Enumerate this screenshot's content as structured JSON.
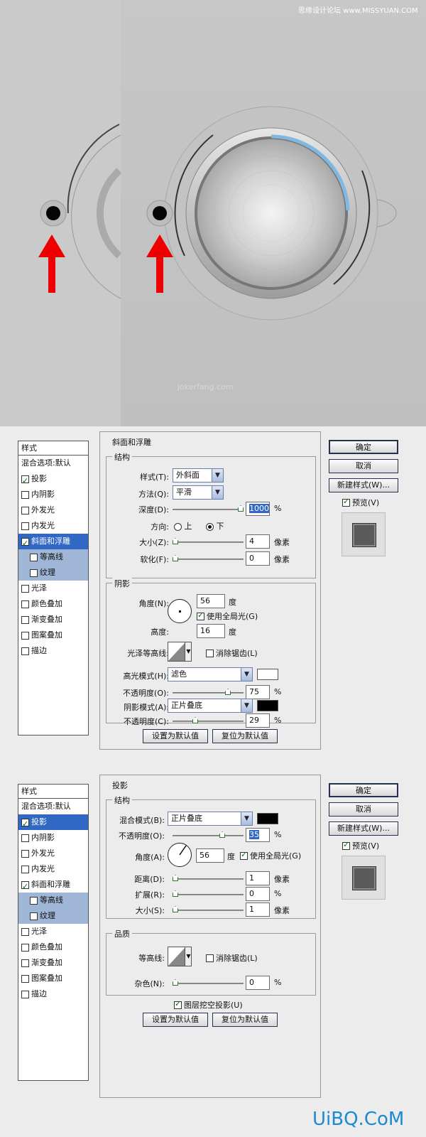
{
  "watermark_top": "思缘设计论坛 www.MISSYUAN.COM",
  "scene_watermark": "jokerfang.com",
  "footer_logo": "UiBQ.CoM",
  "panel1": {
    "styles_header": "样式",
    "styles": [
      {
        "label": "混合选项:默认",
        "check": null,
        "sub": false,
        "sel": false
      },
      {
        "label": "投影",
        "check": true,
        "sub": false,
        "sel": false
      },
      {
        "label": "内阴影",
        "check": false,
        "sub": false,
        "sel": false
      },
      {
        "label": "外发光",
        "check": false,
        "sub": false,
        "sel": false
      },
      {
        "label": "内发光",
        "check": false,
        "sub": false,
        "sel": false
      },
      {
        "label": "斜面和浮雕",
        "check": true,
        "sub": false,
        "sel": true
      },
      {
        "label": "等高线",
        "check": false,
        "sub": true,
        "sel": false
      },
      {
        "label": "纹理",
        "check": false,
        "sub": true,
        "sel": false
      },
      {
        "label": "光泽",
        "check": false,
        "sub": false,
        "sel": false
      },
      {
        "label": "颜色叠加",
        "check": false,
        "sub": false,
        "sel": false
      },
      {
        "label": "渐变叠加",
        "check": false,
        "sub": false,
        "sel": false
      },
      {
        "label": "图案叠加",
        "check": false,
        "sub": false,
        "sel": false
      },
      {
        "label": "描边",
        "check": false,
        "sub": false,
        "sel": false
      }
    ],
    "section_title": "斜面和浮雕",
    "structure_title": "结构",
    "style_label": "样式(T):",
    "style_value": "外斜面",
    "method_label": "方法(Q):",
    "method_value": "平滑",
    "depth_label": "深度(D):",
    "depth_value": "1000",
    "depth_unit": "%",
    "depth_pct": 100,
    "direction_label": "方向:",
    "dir_up": "上",
    "dir_down": "下",
    "size_label": "大小(Z):",
    "size_value": "4",
    "size_unit": "像素",
    "soften_label": "软化(F):",
    "soften_value": "0",
    "soften_unit": "像素",
    "shading_title": "阴影",
    "angle_label": "角度(N):",
    "angle_value": "56",
    "angle_unit": "度",
    "global_light": "使用全局光(G)",
    "altitude_label": "高度:",
    "altitude_value": "16",
    "altitude_unit": "度",
    "gloss_label": "光泽等高线:",
    "antialias": "消除锯齿(L)",
    "highlight_label": "高光模式(H):",
    "highlight_value": "滤色",
    "highlight_color": "#ffffff",
    "hl_opacity_label": "不透明度(O):",
    "hl_opacity_value": "75",
    "hl_opacity_unit": "%",
    "shadow_label": "阴影模式(A):",
    "shadow_value": "正片叠底",
    "shadow_color": "#000000",
    "sh_opacity_label": "不透明度(C):",
    "sh_opacity_value": "29",
    "sh_opacity_unit": "%",
    "make_default": "设置为默认值",
    "reset_default": "复位为默认值",
    "ok": "确定",
    "cancel": "取消",
    "new_style": "新建样式(W)...",
    "preview": "预览(V)"
  },
  "panel2": {
    "styles_header": "样式",
    "styles": [
      {
        "label": "混合选项:默认",
        "check": null,
        "sub": false,
        "sel": false
      },
      {
        "label": "投影",
        "check": true,
        "sub": false,
        "sel": true
      },
      {
        "label": "内阴影",
        "check": false,
        "sub": false,
        "sel": false
      },
      {
        "label": "外发光",
        "check": false,
        "sub": false,
        "sel": false
      },
      {
        "label": "内发光",
        "check": false,
        "sub": false,
        "sel": false
      },
      {
        "label": "斜面和浮雕",
        "check": true,
        "sub": false,
        "sel": false
      },
      {
        "label": "等高线",
        "check": false,
        "sub": true,
        "sel": false
      },
      {
        "label": "纹理",
        "check": false,
        "sub": true,
        "sel": false
      },
      {
        "label": "光泽",
        "check": false,
        "sub": false,
        "sel": false
      },
      {
        "label": "颜色叠加",
        "check": false,
        "sub": false,
        "sel": false
      },
      {
        "label": "渐变叠加",
        "check": false,
        "sub": false,
        "sel": false
      },
      {
        "label": "图案叠加",
        "check": false,
        "sub": false,
        "sel": false
      },
      {
        "label": "描边",
        "check": false,
        "sub": false,
        "sel": false
      }
    ],
    "section_title": "投影",
    "structure_title": "结构",
    "blend_label": "混合模式(B):",
    "blend_value": "正片叠底",
    "blend_color": "#000000",
    "opacity_label": "不透明度(O):",
    "opacity_value": "35",
    "opacity_unit": "%",
    "angle_label": "角度(A):",
    "angle_value": "56",
    "angle_unit": "度",
    "global_light": "使用全局光(G)",
    "distance_label": "距离(D):",
    "distance_value": "1",
    "distance_unit": "像素",
    "spread_label": "扩展(R):",
    "spread_value": "0",
    "spread_unit": "%",
    "size_label": "大小(S):",
    "size_value": "1",
    "size_unit": "像素",
    "quality_title": "品质",
    "contour_label": "等高线:",
    "antialias": "消除锯齿(L)",
    "noise_label": "杂色(N):",
    "noise_value": "0",
    "noise_unit": "%",
    "knockout": "图层挖空投影(U)",
    "make_default": "设置为默认值",
    "reset_default": "复位为默认值",
    "ok": "确定",
    "cancel": "取消",
    "new_style": "新建样式(W)...",
    "preview": "预览(V)"
  }
}
